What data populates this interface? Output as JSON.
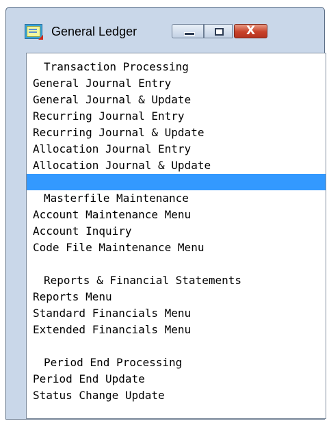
{
  "window": {
    "title": "General Ledger",
    "icon": "ledger-icon",
    "controls": {
      "minimize": "minimize-icon",
      "maximize": "maximize-icon",
      "close": "close-icon",
      "close_glyph": "X"
    }
  },
  "menu": {
    "rows": [
      {
        "kind": "header",
        "text": "Transaction Processing"
      },
      {
        "kind": "item",
        "text": "General Journal Entry"
      },
      {
        "kind": "item",
        "text": "General Journal & Update"
      },
      {
        "kind": "item",
        "text": "Recurring Journal Entry"
      },
      {
        "kind": "item",
        "text": "Recurring Journal & Update"
      },
      {
        "kind": "item",
        "text": "Allocation Journal Entry"
      },
      {
        "kind": "item",
        "text": "Allocation Journal & Update"
      },
      {
        "kind": "selected",
        "text": ""
      },
      {
        "kind": "header",
        "text": "Masterfile Maintenance"
      },
      {
        "kind": "item",
        "text": "Account Maintenance Menu"
      },
      {
        "kind": "item",
        "text": "Account Inquiry"
      },
      {
        "kind": "item",
        "text": "Code File Maintenance Menu"
      },
      {
        "kind": "blank",
        "text": ""
      },
      {
        "kind": "header",
        "text": "Reports & Financial Statements"
      },
      {
        "kind": "item",
        "text": "Reports Menu"
      },
      {
        "kind": "item",
        "text": "Standard Financials Menu"
      },
      {
        "kind": "item",
        "text": "Extended Financials Menu"
      },
      {
        "kind": "blank",
        "text": ""
      },
      {
        "kind": "header",
        "text": "Period End Processing"
      },
      {
        "kind": "item",
        "text": "Period End Update"
      },
      {
        "kind": "item",
        "text": "Status Change Update"
      }
    ],
    "selection_color": "#3399ff"
  }
}
